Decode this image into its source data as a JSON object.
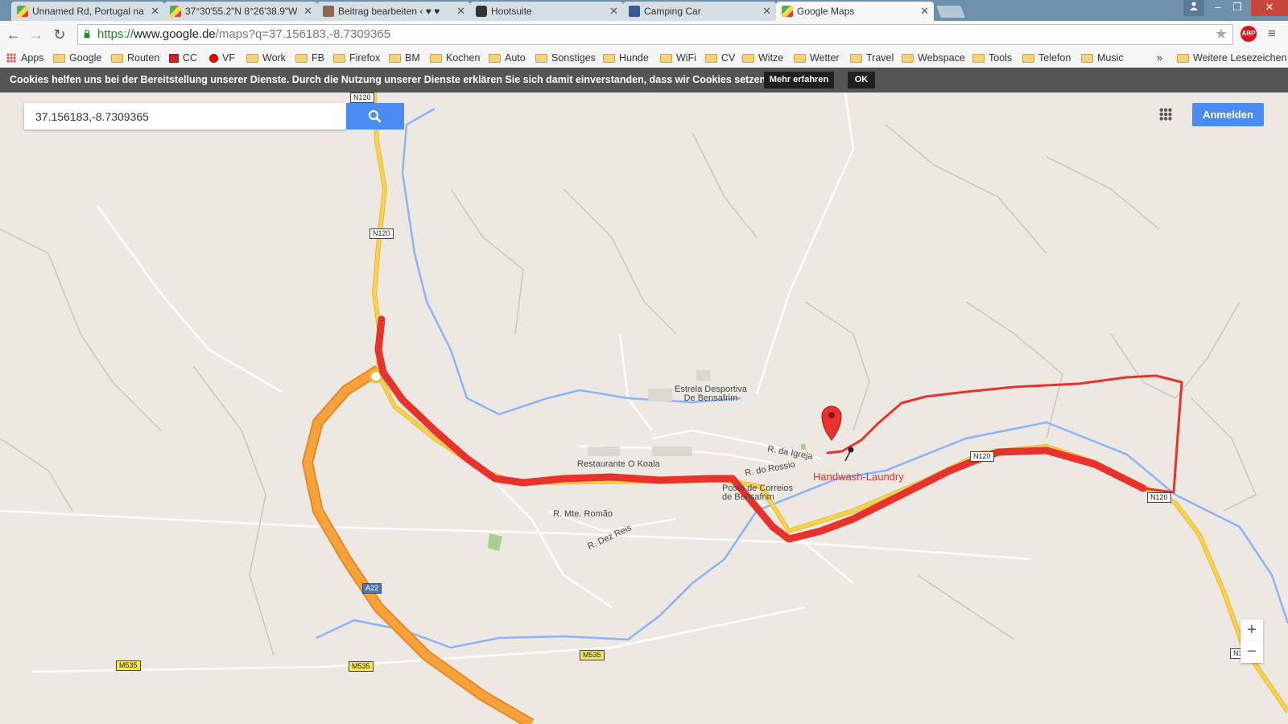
{
  "tabs": [
    {
      "title": "Unnamed Rd, Portugal na",
      "favicon": "google-maps"
    },
    {
      "title": "37°30'55.2\"N 8°26'38.9\"W",
      "favicon": "google-maps"
    },
    {
      "title": "Beitrag bearbeiten ‹ ♥ ♥",
      "favicon": "camper"
    },
    {
      "title": "Hootsuite",
      "favicon": "hootsuite"
    },
    {
      "title": "Camping Car",
      "favicon": "facebook"
    },
    {
      "title": "Google Maps",
      "favicon": "google-maps",
      "active": true
    }
  ],
  "address_bar": {
    "scheme": "https://",
    "host": "www.google.de",
    "path": "/maps?q=37.156183,-8.7309365"
  },
  "extensions": {
    "abp": "ABP"
  },
  "bookmarks": {
    "apps": "Apps",
    "items": [
      "Google",
      "Routen",
      "CC",
      "VF",
      "Work",
      "FB",
      "Firefox",
      "BM",
      "Kochen",
      "Auto",
      "Sonstiges",
      "Hunde",
      "WiFi",
      "CV",
      "Witze",
      "Wetter",
      "Travel",
      "Webspace",
      "Tools",
      "Telefon",
      "Music"
    ],
    "overflow": "»",
    "other": "Weitere Lesezeichen"
  },
  "cookie_bar": {
    "text": "Cookies helfen uns bei der Bereitstellung unserer Dienste. Durch die Nutzung unserer Dienste erklären Sie sich damit einverstanden, dass wir Cookies setzen.",
    "learn_more": "Mehr erfahren",
    "ok": "OK"
  },
  "maps": {
    "search_value": "37.156183,-8.7309365",
    "sign_in": "Anmelden",
    "zoom_in": "+",
    "zoom_out": "−",
    "labels": {
      "club": "Estrela Desportiva\nDe Bensafrim",
      "restaurant": "Restaurante O Koala",
      "post_office": "Posto de Correios\nde Bensafrim",
      "street_igreja": "R. da Igreja",
      "street_rossio": "R. do Rossio",
      "street_romao": "R. Mte. Romão",
      "street_reis": "R. Dez Reis",
      "annotation": "Handwash-Laundry"
    },
    "shields": {
      "n120_top": "N120",
      "n120_a": "N120",
      "n120_b": "N120",
      "n120_c": "N120",
      "n120_edge": "N1",
      "a22": "A22",
      "m535_a": "M535",
      "m535_b": "M535",
      "m535_c": "M535"
    },
    "colors": {
      "route": "#e8322c",
      "motorway": "#f7a13a",
      "national": "#fad24a",
      "river": "#8ab4f8",
      "background": "#ede9e2"
    }
  }
}
